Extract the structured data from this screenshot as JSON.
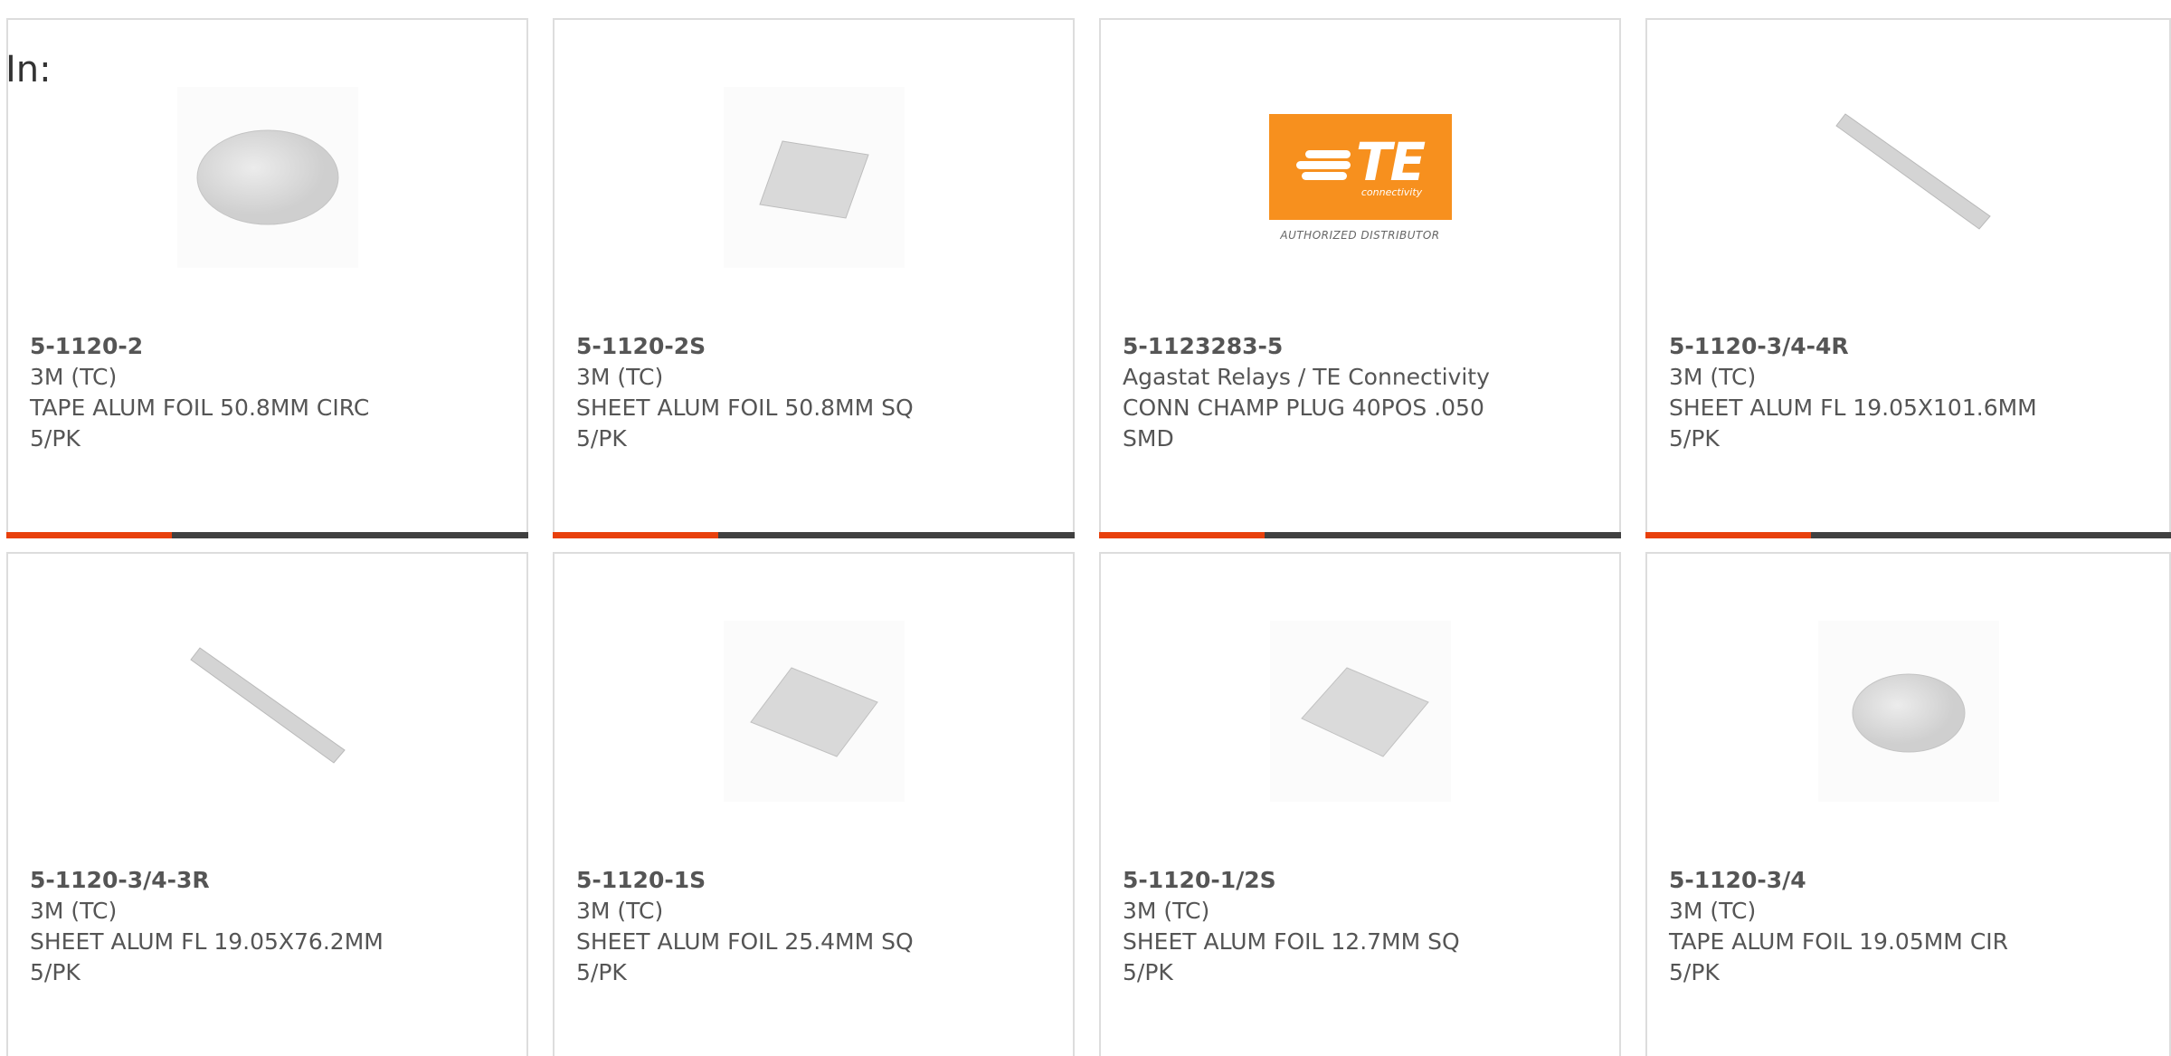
{
  "filter_label": "In:",
  "colors": {
    "accent": "#e8400c",
    "bar": "#404040",
    "border": "#dddddd",
    "te_orange": "#f7901e"
  },
  "te_logo": {
    "main": "TE",
    "sub": "connectivity",
    "authorized": "AUTHORIZED DISTRIBUTOR"
  },
  "products": [
    {
      "part": "5-1120-2",
      "mfr": "3M (TC)",
      "desc": "TAPE ALUM FOIL 50.8MM CIRC",
      "pack": "5/PK",
      "image": "circle-foil-icon"
    },
    {
      "part": "5-1120-2S",
      "mfr": "3M (TC)",
      "desc": "SHEET ALUM FOIL 50.8MM SQ",
      "pack": "5/PK",
      "image": "square-foil-icon"
    },
    {
      "part": "5-1123283-5",
      "mfr": "Agastat Relays / TE Connectivity",
      "desc": "CONN CHAMP PLUG 40POS .050",
      "pack": "SMD",
      "image": "te-logo"
    },
    {
      "part": "5-1120-3/4-4R",
      "mfr": "3M (TC)",
      "desc": "SHEET ALUM FL 19.05X101.6MM",
      "pack": "5/PK",
      "image": "strip-foil-icon"
    },
    {
      "part": "5-1120-3/4-3R",
      "mfr": "3M (TC)",
      "desc": "SHEET ALUM FL 19.05X76.2MM",
      "pack": "5/PK",
      "image": "strip-foil-icon"
    },
    {
      "part": "5-1120-1S",
      "mfr": "3M (TC)",
      "desc": "SHEET ALUM FOIL 25.4MM SQ",
      "pack": "5/PK",
      "image": "square-foil-icon"
    },
    {
      "part": "5-1120-1/2S",
      "mfr": "3M (TC)",
      "desc": "SHEET ALUM FOIL 12.7MM SQ",
      "pack": "5/PK",
      "image": "square-foil-icon"
    },
    {
      "part": "5-1120-3/4",
      "mfr": "3M (TC)",
      "desc": "TAPE ALUM FOIL 19.05MM CIR",
      "pack": "5/PK",
      "image": "circle-foil-icon"
    }
  ]
}
